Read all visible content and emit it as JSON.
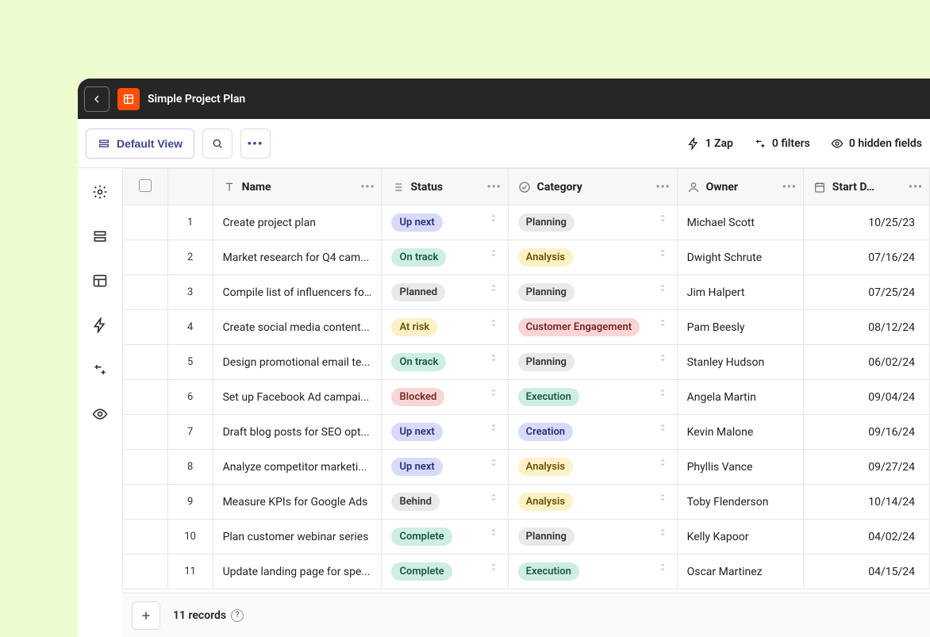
{
  "app": {
    "title": "Simple Project Plan"
  },
  "toolbar": {
    "view_label": "Default View",
    "zap_count": "1 Zap",
    "filters": "0 filters",
    "hidden_fields": "0 hidden fields"
  },
  "columns": {
    "name": "Name",
    "status": "Status",
    "category": "Category",
    "owner": "Owner",
    "start_date": "Start D…"
  },
  "status_colors": {
    "Up next": {
      "bg": "#d7dbf9",
      "fg": "#2a2f7a"
    },
    "On track": {
      "bg": "#cdeee0",
      "fg": "#1b5a42"
    },
    "Planned": {
      "bg": "#e9e9e9",
      "fg": "#333333"
    },
    "At risk": {
      "bg": "#fdf1c7",
      "fg": "#6a5300"
    },
    "Blocked": {
      "bg": "#f8d6d6",
      "fg": "#7a2626"
    },
    "Behind": {
      "bg": "#e9e9e9",
      "fg": "#333333"
    },
    "Complete": {
      "bg": "#cdeee0",
      "fg": "#1b5a42"
    }
  },
  "category_colors": {
    "Planning": {
      "bg": "#e9e9e9",
      "fg": "#333333"
    },
    "Analysis": {
      "bg": "#fdf1c7",
      "fg": "#6a5300"
    },
    "Customer Engagement": {
      "bg": "#f8d6d6",
      "fg": "#7a2626"
    },
    "Execution": {
      "bg": "#cdeee0",
      "fg": "#1b5a42"
    },
    "Creation": {
      "bg": "#d7dbf9",
      "fg": "#2a2f7a"
    }
  },
  "rows": [
    {
      "n": "1",
      "name": "Create project plan",
      "status": "Up next",
      "category": "Planning",
      "owner": "Michael Scott",
      "start": "10/25/23"
    },
    {
      "n": "2",
      "name": "Market research for Q4 cam...",
      "status": "On track",
      "category": "Analysis",
      "owner": "Dwight Schrute",
      "start": "07/16/24"
    },
    {
      "n": "3",
      "name": "Compile list of influencers fo...",
      "status": "Planned",
      "category": "Planning",
      "owner": "Jim Halpert",
      "start": "07/25/24"
    },
    {
      "n": "4",
      "name": "Create social media content...",
      "status": "At risk",
      "category": "Customer Engagement",
      "owner": "Pam Beesly",
      "start": "08/12/24"
    },
    {
      "n": "5",
      "name": "Design promotional email te...",
      "status": "On track",
      "category": "Planning",
      "owner": "Stanley Hudson",
      "start": "06/02/24"
    },
    {
      "n": "6",
      "name": "Set up Facebook Ad campai...",
      "status": "Blocked",
      "category": "Execution",
      "owner": "Angela Martin",
      "start": "09/04/24"
    },
    {
      "n": "7",
      "name": "Draft blog posts for SEO opt...",
      "status": "Up next",
      "category": "Creation",
      "owner": "Kevin Malone",
      "start": "09/16/24"
    },
    {
      "n": "8",
      "name": "Analyze competitor marketi...",
      "status": "Up next",
      "category": "Analysis",
      "owner": "Phyllis Vance",
      "start": "09/27/24"
    },
    {
      "n": "9",
      "name": "Measure KPIs for Google Ads",
      "status": "Behind",
      "category": "Analysis",
      "owner": "Toby Flenderson",
      "start": "10/14/24"
    },
    {
      "n": "10",
      "name": "Plan customer webinar series",
      "status": "Complete",
      "category": "Planning",
      "owner": "Kelly Kapoor",
      "start": "04/02/24"
    },
    {
      "n": "11",
      "name": "Update landing page for spe...",
      "status": "Complete",
      "category": "Execution",
      "owner": "Oscar Martinez",
      "start": "04/15/24"
    }
  ],
  "footer": {
    "records": "11 records"
  }
}
